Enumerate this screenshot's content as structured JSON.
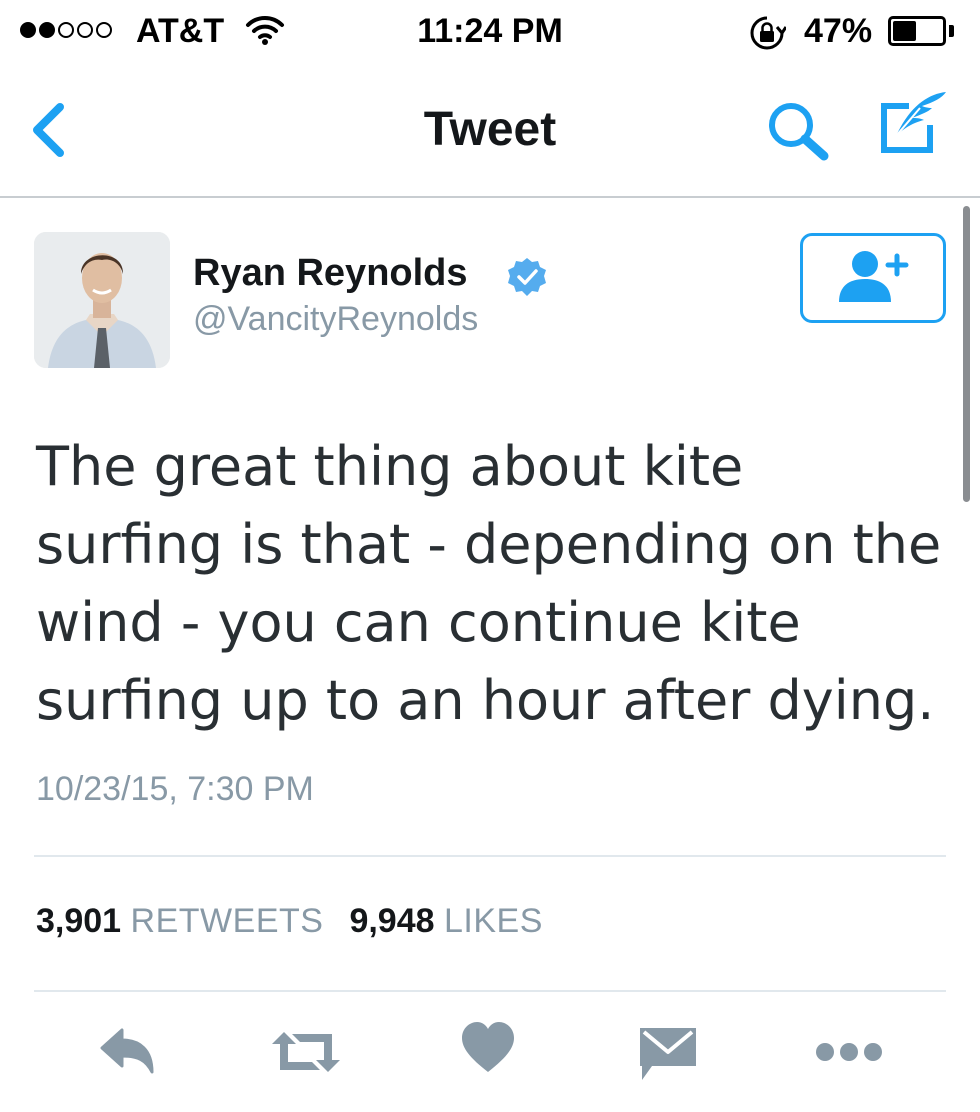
{
  "status_bar": {
    "carrier": "AT&T",
    "signal_bars": 2,
    "signal_total": 5,
    "time": "11:24 PM",
    "battery_percent": "47%",
    "battery_level": 0.47
  },
  "nav": {
    "title": "Tweet"
  },
  "tweet": {
    "author": {
      "name": "Ryan Reynolds",
      "handle": "@VancityReynolds",
      "verified": true
    },
    "text": "The great thing about kite surfing is that - depending on the wind - you can continue kite surfing up to an hour after dying.",
    "timestamp": "10/23/15, 7:30 PM",
    "stats": {
      "retweets_count": "3,901",
      "retweets_label": "RETWEETS",
      "likes_count": "9,948",
      "likes_label": "LIKES"
    }
  },
  "colors": {
    "accent": "#1da1f2",
    "icon_gray": "#8899a6",
    "text": "#14171a"
  },
  "icons": [
    "back-chevron",
    "search",
    "compose",
    "verified-badge",
    "follow-user",
    "reply",
    "retweet",
    "like",
    "direct-message",
    "more"
  ]
}
